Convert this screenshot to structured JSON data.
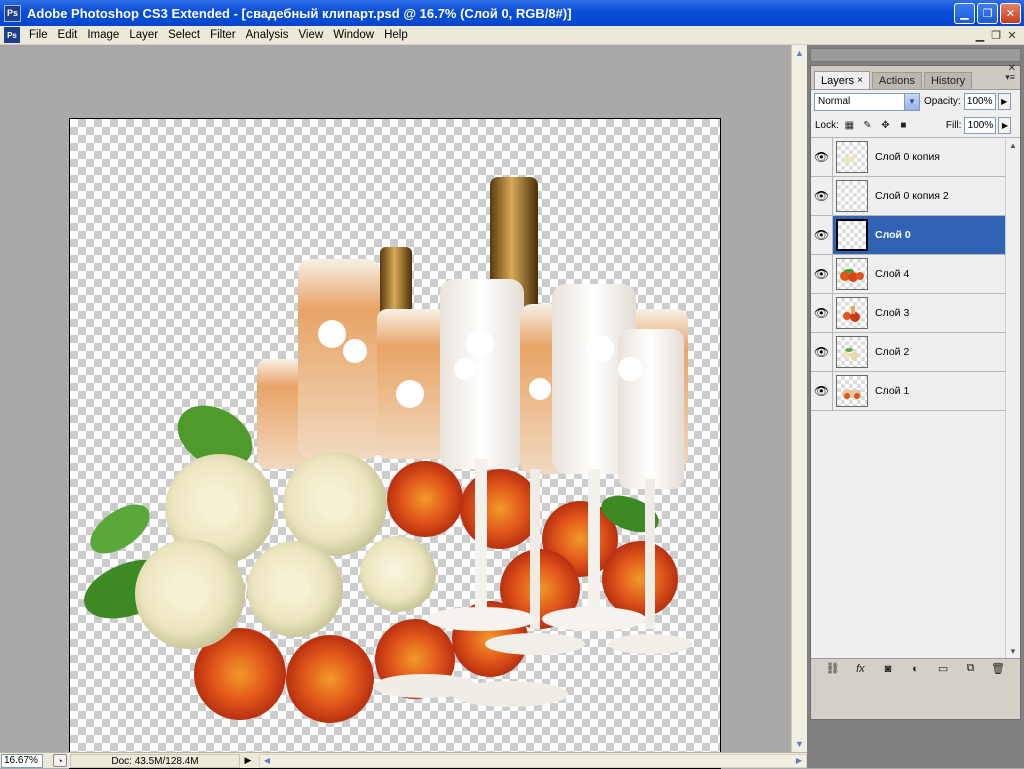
{
  "app": {
    "icon_label": "Ps",
    "title": "Adobe Photoshop CS3 Extended - [свадебный клипарт.psd @ 16.7% (Слой 0, RGB/8#)]"
  },
  "menu": {
    "items": [
      "File",
      "Edit",
      "Image",
      "Layer",
      "Select",
      "Filter",
      "Analysis",
      "View",
      "Window",
      "Help"
    ]
  },
  "status": {
    "zoom": "16.67%",
    "doc": "Doc: 43.5M/128.4M"
  },
  "layers_panel": {
    "tabs": [
      "Layers",
      "Actions",
      "History"
    ],
    "active_tab": "Layers",
    "blend_mode": "Normal",
    "opacity_label": "Opacity:",
    "opacity": "100%",
    "lock_label": "Lock:",
    "fill_label": "Fill:",
    "fill": "100%",
    "selected_layer": "Слой 0",
    "layers": [
      {
        "name": "Слой 0 копия",
        "visible": true
      },
      {
        "name": "Слой 0 копия 2",
        "visible": true
      },
      {
        "name": "Слой 0",
        "visible": true,
        "selected": true
      },
      {
        "name": "Слой 4",
        "visible": true
      },
      {
        "name": "Слой 3",
        "visible": true
      },
      {
        "name": "Слой 2",
        "visible": true
      },
      {
        "name": "Слой 1",
        "visible": true
      }
    ]
  },
  "icons": {
    "visibility": "eye-icon",
    "bottom_bar": [
      "link-layers-icon",
      "fx-icon",
      "layer-mask-icon",
      "adjustment-layer-icon",
      "new-group-icon",
      "new-layer-icon",
      "delete-layer-icon"
    ]
  },
  "colors": {
    "titlebar": "#0a4ed6",
    "selection": "#3163b4",
    "workspace": "#a9a9a9"
  }
}
